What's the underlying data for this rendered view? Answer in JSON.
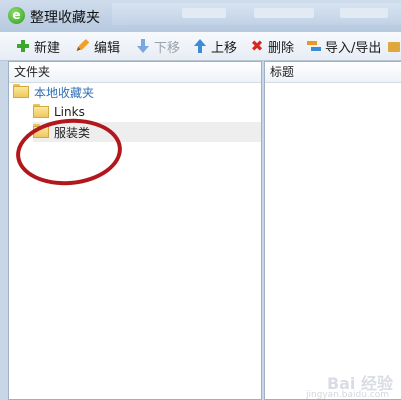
{
  "window": {
    "title": "整理收藏夹",
    "app_icon": "ie-e-icon"
  },
  "toolbar": {
    "new_label": "新建",
    "edit_label": "编辑",
    "move_down_label": "下移",
    "move_up_label": "上移",
    "delete_label": "删除",
    "import_export_label": "导入/导出"
  },
  "left_pane": {
    "header": "文件夹",
    "tree": [
      {
        "label": "本地收藏夹",
        "level": 0
      },
      {
        "label": "Links",
        "level": 1
      },
      {
        "label": "服装类",
        "level": 1,
        "selected": true
      }
    ]
  },
  "right_pane": {
    "header": "标题"
  },
  "watermark": {
    "text": "Bai 经验",
    "sub": "jingyan.baidu.com"
  },
  "colors": {
    "annotation_circle": "#b1171c",
    "root_folder_text": "#2f6fb8"
  }
}
